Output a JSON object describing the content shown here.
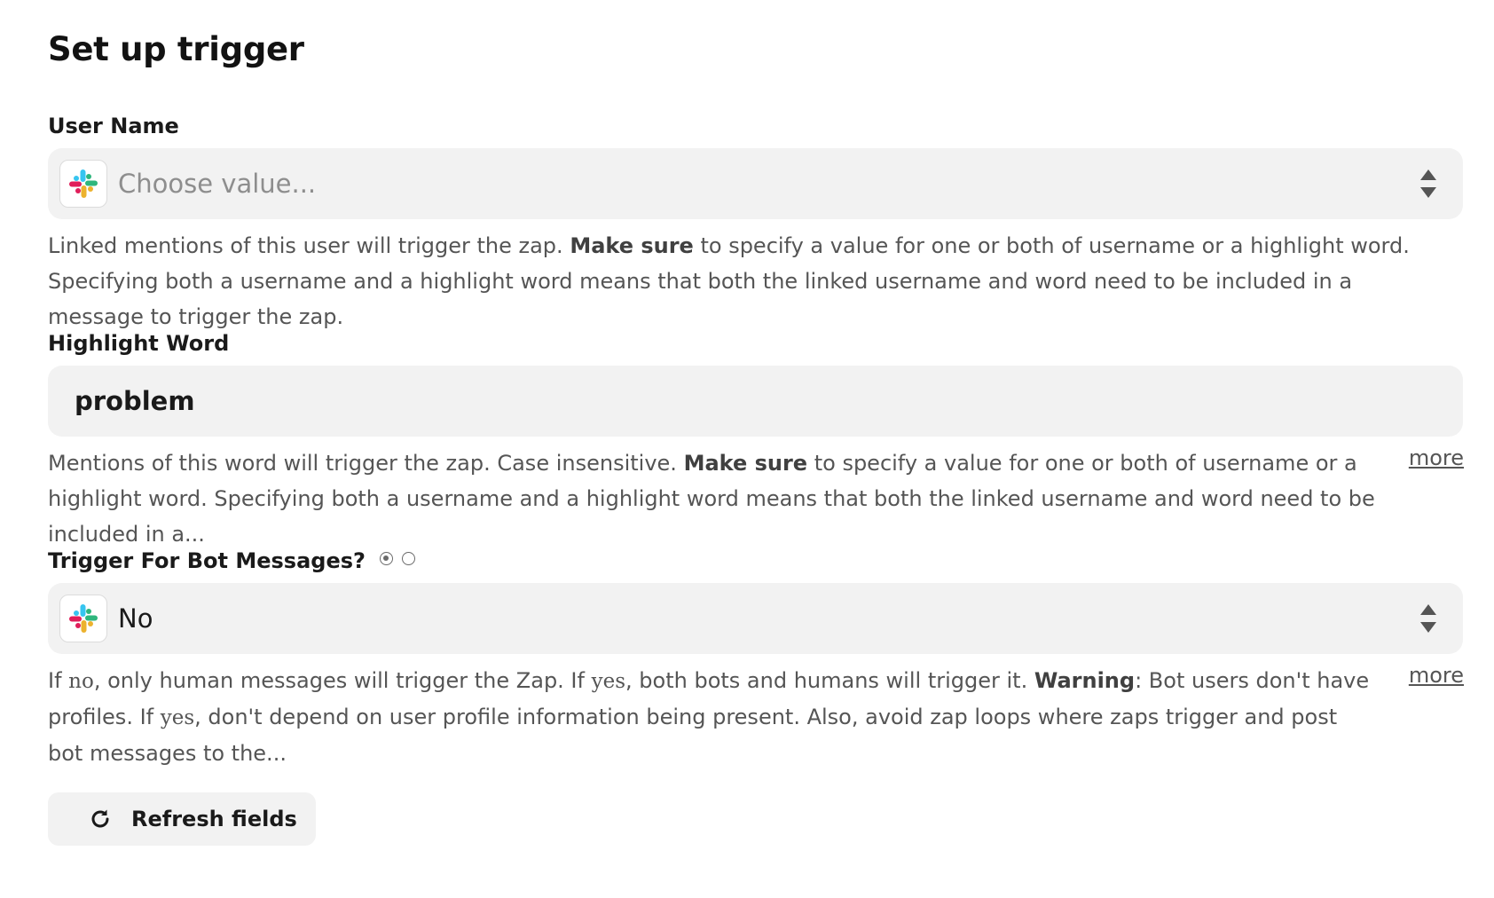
{
  "header": {
    "title": "Set up trigger"
  },
  "fields": {
    "user_name": {
      "label": "User Name",
      "placeholder": "Choose value...",
      "icon": "slack-icon",
      "help_prefix": "Linked mentions of this user will trigger the zap.",
      "help_bold": "Make sure",
      "help_suffix": "to specify a value for one or both of username or a highlight word. Specifying both a username and a highlight word means that both the linked username and word need to be included in a message to trigger the zap."
    },
    "highlight_word": {
      "label": "Highlight Word",
      "value": "problem",
      "help_prefix": "Mentions of this word will trigger the zap. Case insensitive.",
      "help_bold": "Make sure",
      "help_suffix": "to specify a value for one or both of username or a highlight word. Specifying both a username and a highlight word means that both the linked username and word need to be included in a...",
      "more_label": "more"
    },
    "bot_messages": {
      "label": "Trigger For Bot Messages?",
      "radio_selected_index": 0,
      "value": "No",
      "icon": "slack-icon",
      "help_part1": "If",
      "help_code_no": "no",
      "help_part2": ", only human messages will trigger the Zap. If",
      "help_code_yes": "yes",
      "help_part3": ", both bots and humans will trigger it.",
      "help_bold": "Warning",
      "help_part4": ": Bot users don't have profiles. If",
      "help_code_yes2": "yes",
      "help_part5": ", don't depend on user profile information being present. Also, avoid zap loops where zaps trigger and post bot messages to the...",
      "more_label": "more"
    }
  },
  "actions": {
    "refresh_label": "Refresh fields",
    "refresh_icon": "refresh-icon"
  },
  "colors": {
    "slack_blue": "#36C5F0",
    "slack_green": "#2EB67D",
    "slack_yellow": "#ECB22E",
    "slack_red": "#E01E5A",
    "control_bg": "#f2f2f2",
    "help_text": "#555555"
  }
}
